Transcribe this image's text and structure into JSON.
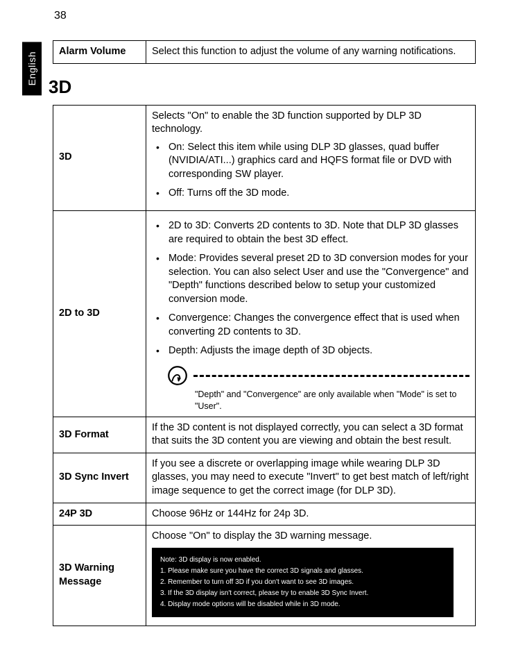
{
  "page_number": "38",
  "language_tab": "English",
  "alarm_table": {
    "label": "Alarm Volume",
    "desc": "Select this function to adjust the volume of any warning notifications."
  },
  "section_heading": "3D",
  "rows": {
    "r1": {
      "label": "3D",
      "intro": "Selects \"On\" to enable the 3D function supported by DLP 3D technology.",
      "b1": "On: Select this item while using DLP 3D glasses, quad buffer (NVIDIA/ATI...) graphics card and HQFS format file or DVD with corresponding SW player.",
      "b2": "Off: Turns off the 3D mode."
    },
    "r2": {
      "label": "2D to 3D",
      "b1": "2D to 3D: Converts 2D contents to 3D. Note that DLP 3D glasses are required to obtain the best 3D effect.",
      "b2": "Mode: Provides several preset 2D to 3D conversion modes for your selection. You can also select User and use the \"Convergence\" and \"Depth\" functions described below to setup your customized conversion mode.",
      "b3": "Convergence: Changes the convergence effect that is used when converting 2D contents to 3D.",
      "b4": "Depth: Adjusts the image depth of 3D objects.",
      "note": "\"Depth\" and \"Convergence\" are only available when \"Mode\" is set to \"User\"."
    },
    "r3": {
      "label": "3D Format",
      "desc": "If the 3D content is not displayed correctly, you can select a 3D format that suits the 3D content you are viewing and obtain the best result."
    },
    "r4": {
      "label": "3D Sync Invert",
      "desc": "If you see a discrete or overlapping image while wearing DLP 3D glasses, you may need to execute \"Invert\" to get best match of left/right image sequence to get the correct image (for DLP 3D)."
    },
    "r5": {
      "label": "24P 3D",
      "desc": "Choose 96Hz or 144Hz for 24p 3D."
    },
    "r6": {
      "label": "3D Warning Message",
      "intro": "Choose \"On\" to display the 3D warning message.",
      "box": {
        "l0": "Note: 3D display is now enabled.",
        "l1": "1. Please make sure you have the correct 3D signals and glasses.",
        "l2": "2. Remember to turn off 3D if you don't want to see 3D images.",
        "l3": "3. If the 3D display isn't correct, please try to enable 3D Sync Invert.",
        "l4": "4. Display mode options will be disabled while in 3D mode."
      }
    }
  }
}
